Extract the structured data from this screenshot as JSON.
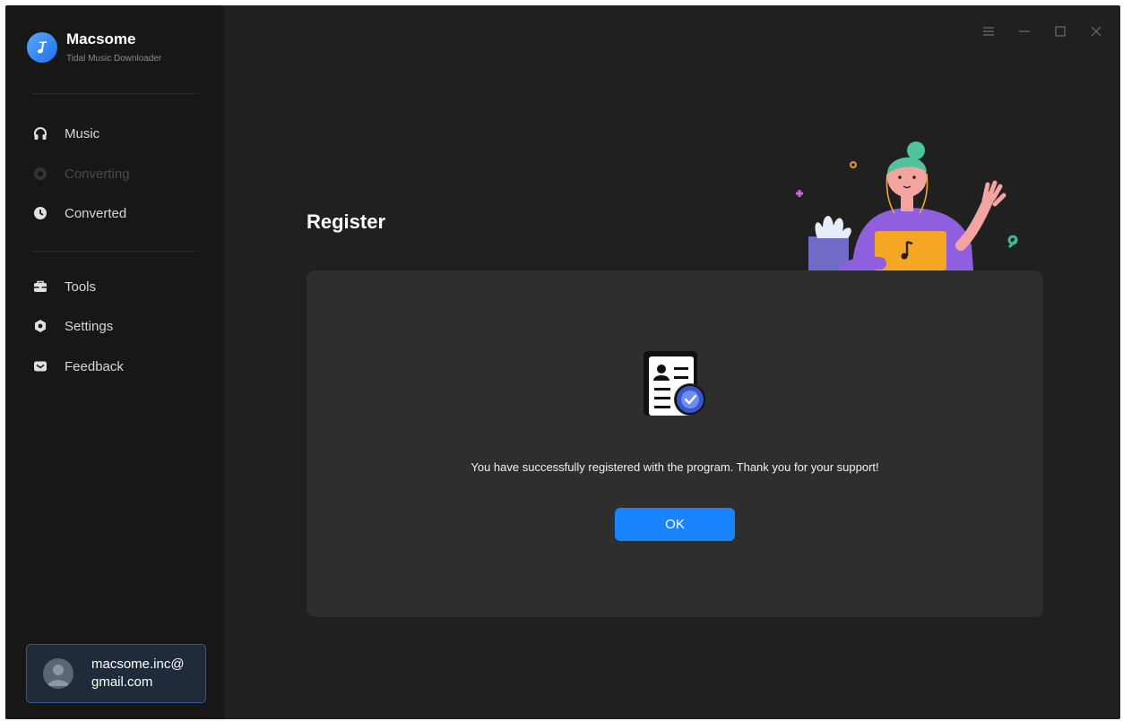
{
  "app": {
    "name": "Macsome",
    "subtitle": "Tidal Music Downloader"
  },
  "sidebar": {
    "items": [
      {
        "label": "Music",
        "icon": "headphones-icon",
        "enabled": true
      },
      {
        "label": "Converting",
        "icon": "converting-icon",
        "enabled": false
      },
      {
        "label": "Converted",
        "icon": "clock-icon",
        "enabled": true
      },
      {
        "label": "Tools",
        "icon": "toolbox-icon",
        "enabled": true
      },
      {
        "label": "Settings",
        "icon": "gear-icon",
        "enabled": true
      },
      {
        "label": "Feedback",
        "icon": "mail-icon",
        "enabled": true
      }
    ]
  },
  "user": {
    "email_line1": "macsome.inc@",
    "email_line2": "gmail.com"
  },
  "window_controls": [
    "menu-icon",
    "minimize-icon",
    "maximize-icon",
    "close-icon"
  ],
  "main": {
    "title": "Register",
    "message": "You have successfully registered with the program. Thank you for your support!",
    "ok_label": "OK"
  },
  "colors": {
    "accent": "#1a84ff",
    "sidebar_bg": "#171717",
    "main_bg": "#202020",
    "panel_bg": "#2e2e2e"
  }
}
